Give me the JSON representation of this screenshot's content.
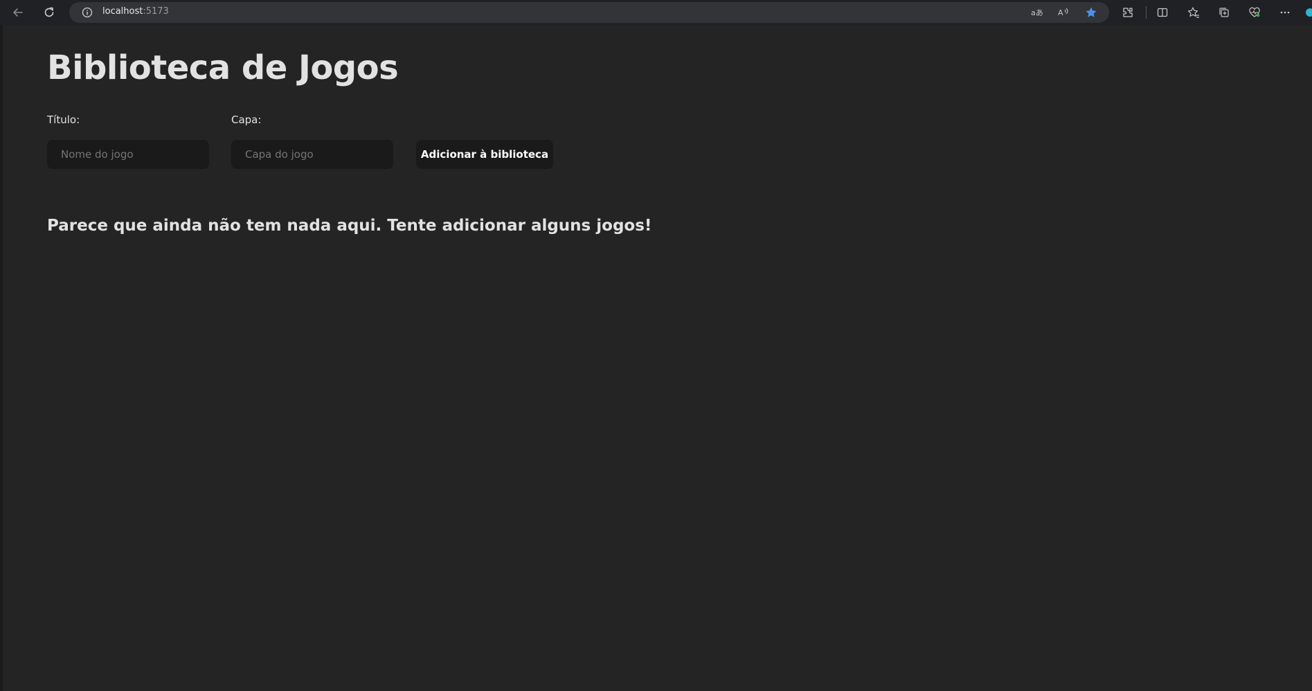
{
  "browser": {
    "url_host": "localhost",
    "url_port": ":5173",
    "icons": {
      "back": "back-arrow-icon",
      "reload": "reload-icon",
      "info": "info-icon",
      "translate": "translate-icon",
      "read_aloud": "read-aloud-icon",
      "favorite": "star-icon",
      "extensions": "extensions-icon",
      "split_screen": "split-screen-icon",
      "favorites": "favorites-icon",
      "collections": "collections-icon",
      "health": "browser-essentials-icon",
      "menu": "more-icon"
    },
    "favorite_color": "#4a90f0"
  },
  "app": {
    "title": "Biblioteca de Jogos",
    "form": {
      "title_label": "Título:",
      "title_placeholder": "Nome do jogo",
      "cover_label": "Capa:",
      "cover_placeholder": "Capa do jogo",
      "submit_label": "Adicionar à biblioteca"
    },
    "empty_message": "Parece que ainda não tem nada aqui. Tente adicionar alguns jogos!"
  },
  "colors": {
    "background": "#242424",
    "input_background": "#1a1a1a",
    "text": "#dedede"
  }
}
